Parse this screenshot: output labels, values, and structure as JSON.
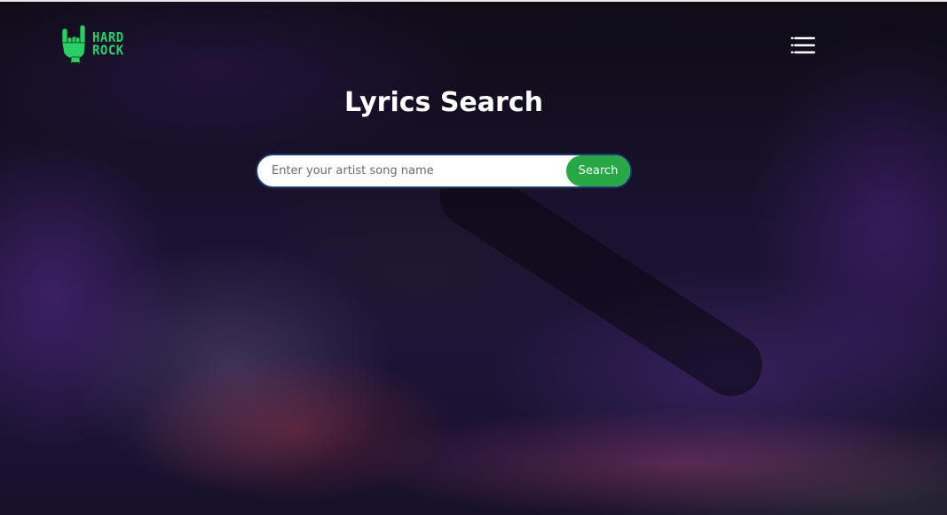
{
  "brand": {
    "logo_line1": "HARD",
    "logo_line2": "ROCK",
    "logo_icon": "rock-hand-icon",
    "accent_color": "#27d164"
  },
  "nav": {
    "menu_icon": "hamburger-menu-icon"
  },
  "main": {
    "title": "Lyrics Search"
  },
  "search": {
    "placeholder": "Enter your artist song name",
    "value": "",
    "button_label": "Search",
    "button_color": "#28a745"
  }
}
